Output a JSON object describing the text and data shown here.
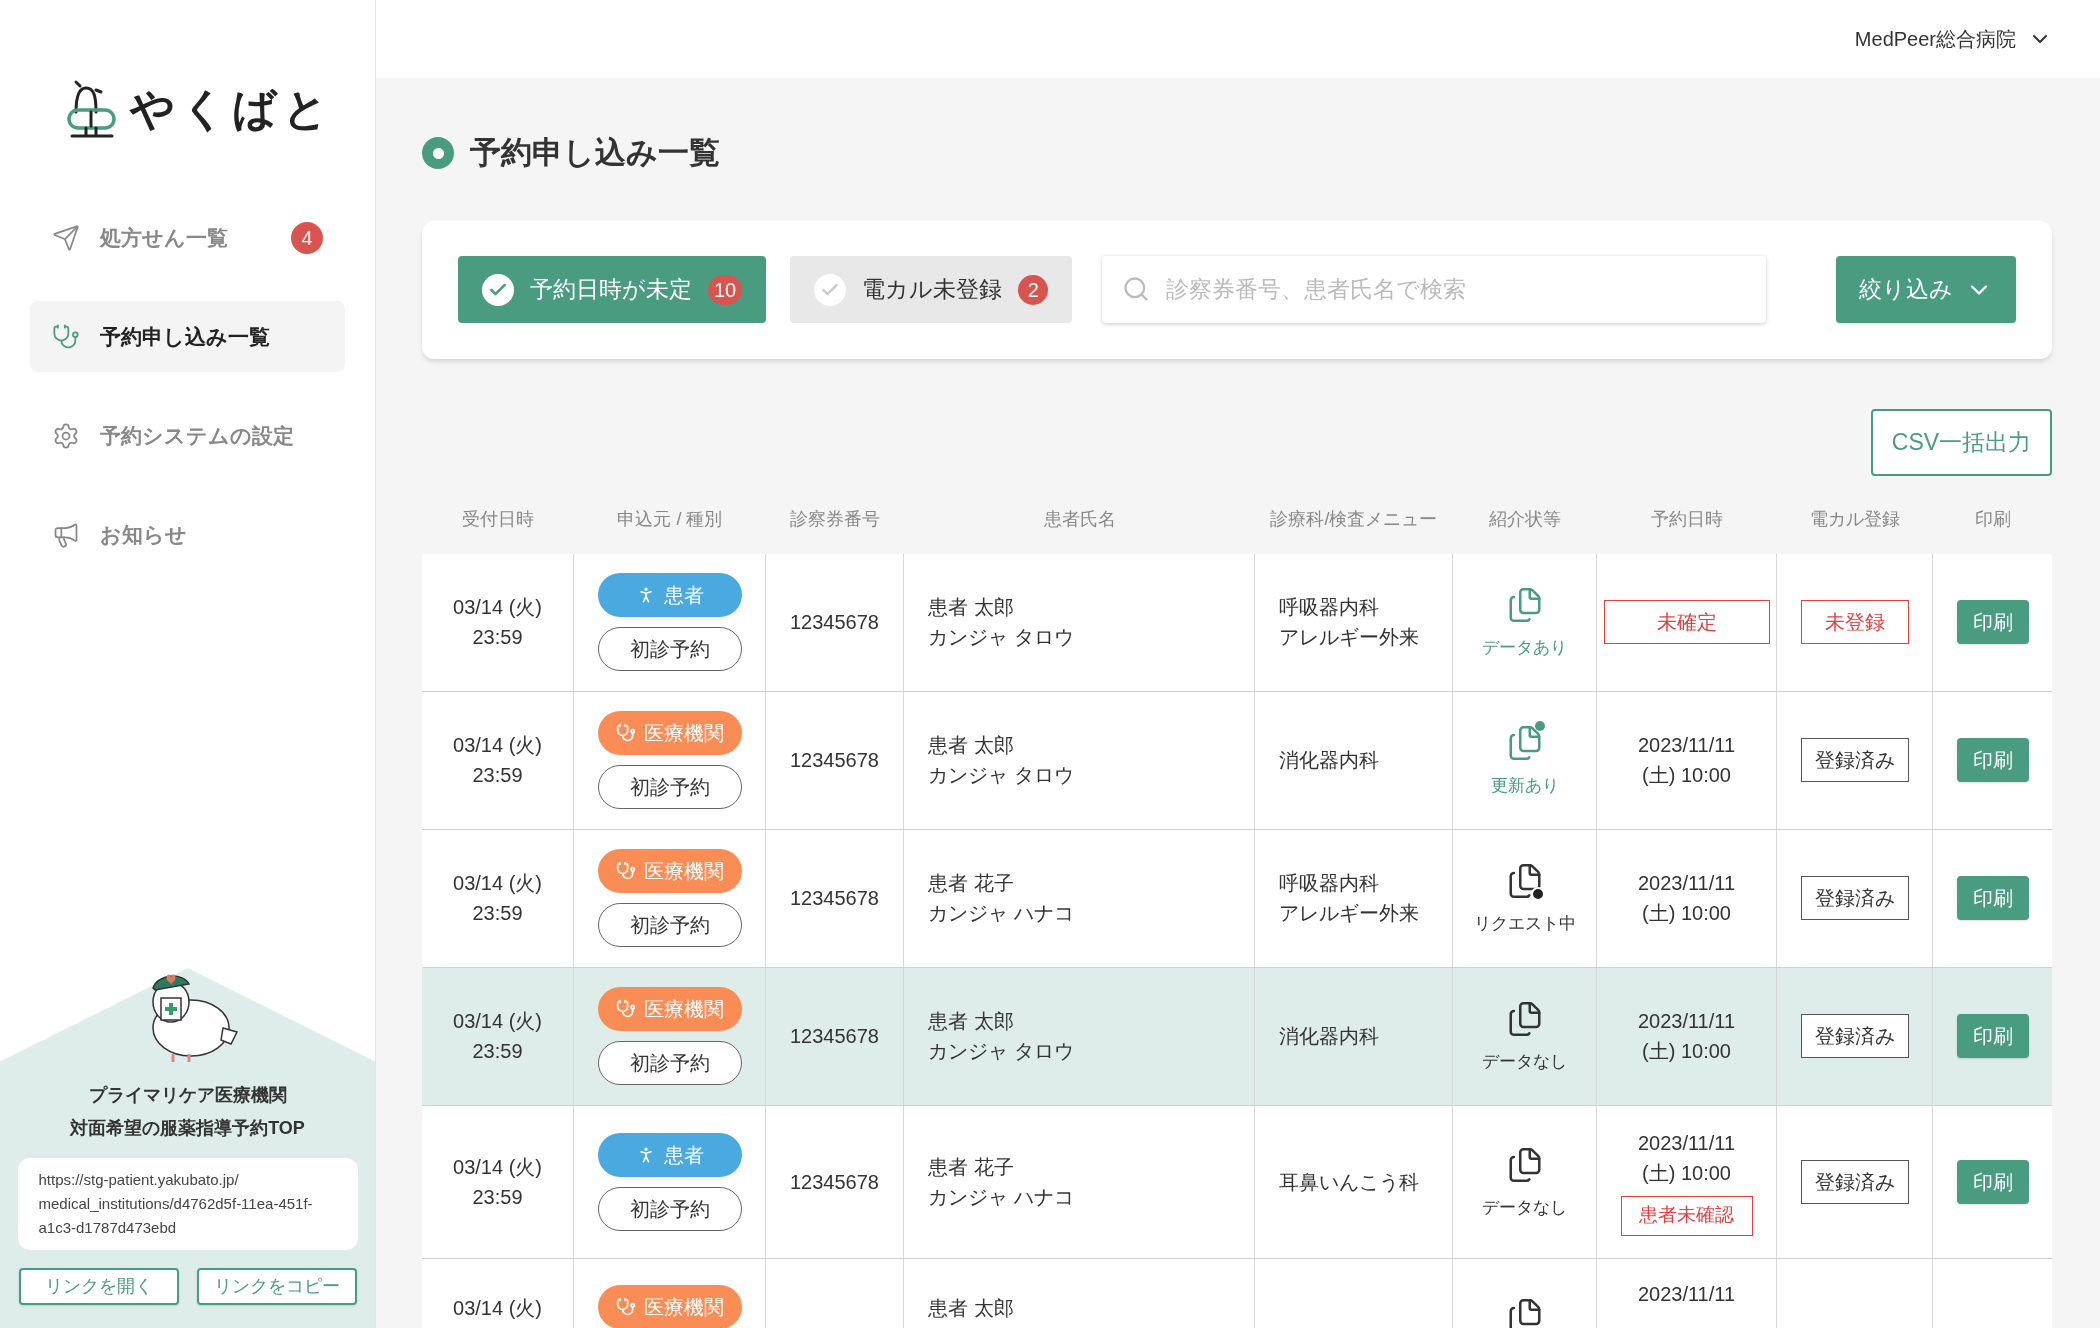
{
  "header": {
    "hospital": "MedPeer総合病院"
  },
  "sidebar": {
    "logo": "やくばと",
    "items": [
      {
        "kind": "send",
        "label": "処方せん一覧",
        "badge": "4",
        "selected": false
      },
      {
        "kind": "stethoscope",
        "label": "予約申し込み一覧",
        "selected": true
      },
      {
        "kind": "gear",
        "label": "予約システムの設定",
        "selected": false
      },
      {
        "kind": "megaphone",
        "label": "お知らせ",
        "selected": false
      }
    ],
    "promo": {
      "title": [
        "プライマリケア医療機関",
        "対面希望の服薬指導予約TOP"
      ],
      "url": "https://stg-patient.yakubato.jp/\nmedical_institutions/d4762d5f-11ea-451f-\na1c3-d1787d473ebd",
      "buttons": [
        "リンクを開く",
        "リンクをコピー"
      ]
    }
  },
  "page": {
    "title": "予約申し込み一覧"
  },
  "filters": {
    "chips": [
      {
        "label": "予約日時が未定",
        "count": "10",
        "selected": true
      },
      {
        "label": "電カル未登録",
        "count": "2",
        "selected": false
      }
    ],
    "search": {
      "placeholder": "診察券番号、患者氏名で検索"
    },
    "refine": "絞り込み"
  },
  "csv_button": "CSV一括出力",
  "table": {
    "columns": [
      "受付日時",
      "申込元 / 種別",
      "診察券番号",
      "患者氏名",
      "診療科/検査メニュー",
      "紹介状等",
      "予約日時",
      "電カル登録",
      "印刷"
    ],
    "rows": [
      {
        "selected": false,
        "received": [
          "03/14 (火)",
          "23:59"
        ],
        "source": {
          "kind": "patient",
          "label": "患者"
        },
        "type": "初診予約",
        "card_no": "12345678",
        "name": [
          "患者 太郎",
          "カンジャ タロウ"
        ],
        "department": [
          "呼吸器内科",
          "アレルギー外来"
        ],
        "referral": {
          "kind": "data",
          "label": "データあり"
        },
        "appointment": {
          "kind": "unset",
          "label": "未確定"
        },
        "karte": {
          "kind": "unregistered",
          "label": "未登録"
        },
        "print": "印刷"
      },
      {
        "selected": false,
        "received": [
          "03/14 (火)",
          "23:59"
        ],
        "source": {
          "kind": "clinic",
          "label": "医療機関"
        },
        "type": "初診予約",
        "card_no": "12345678",
        "name": [
          "患者 太郎",
          "カンジャ タロウ"
        ],
        "department": [
          "消化器内科"
        ],
        "referral": {
          "kind": "updated",
          "label": "更新あり"
        },
        "appointment": {
          "kind": "set",
          "lines": [
            "2023/11/11",
            "(土) 10:00"
          ]
        },
        "karte": {
          "kind": "registered",
          "label": "登録済み"
        },
        "print": "印刷"
      },
      {
        "selected": false,
        "received": [
          "03/14 (火)",
          "23:59"
        ],
        "source": {
          "kind": "clinic",
          "label": "医療機関"
        },
        "type": "初診予約",
        "card_no": "12345678",
        "name": [
          "患者 花子",
          "カンジャ ハナコ"
        ],
        "department": [
          "呼吸器内科",
          "アレルギー外来"
        ],
        "referral": {
          "kind": "request",
          "label": "リクエスト中"
        },
        "appointment": {
          "kind": "set",
          "lines": [
            "2023/11/11",
            "(土) 10:00"
          ]
        },
        "karte": {
          "kind": "registered",
          "label": "登録済み"
        },
        "print": "印刷"
      },
      {
        "selected": true,
        "received": [
          "03/14 (火)",
          "23:59"
        ],
        "source": {
          "kind": "clinic",
          "label": "医療機関"
        },
        "type": "初診予約",
        "card_no": "12345678",
        "name": [
          "患者 太郎",
          "カンジャ タロウ"
        ],
        "department": [
          "消化器内科"
        ],
        "referral": {
          "kind": "none",
          "label": "データなし"
        },
        "appointment": {
          "kind": "set",
          "lines": [
            "2023/11/11",
            "(土) 10:00"
          ]
        },
        "karte": {
          "kind": "registered",
          "label": "登録済み"
        },
        "print": "印刷"
      },
      {
        "selected": false,
        "received": [
          "03/14 (火)",
          "23:59"
        ],
        "source": {
          "kind": "patient",
          "label": "患者"
        },
        "type": "初診予約",
        "card_no": "12345678",
        "name": [
          "患者 花子",
          "カンジャ ハナコ"
        ],
        "department": [
          "耳鼻いんこう科"
        ],
        "referral": {
          "kind": "none",
          "label": "データなし"
        },
        "appointment": {
          "kind": "set",
          "lines": [
            "2023/11/11",
            "(土) 10:00"
          ],
          "warning": "患者未確認"
        },
        "karte": {
          "kind": "registered",
          "label": "登録済み"
        },
        "print": "印刷"
      }
    ],
    "partial_row": {
      "received": "03/14 (火)",
      "source": {
        "kind": "clinic",
        "label": "医療機関"
      },
      "name": "患者 太郎",
      "appointment": "2023/11/11"
    }
  }
}
